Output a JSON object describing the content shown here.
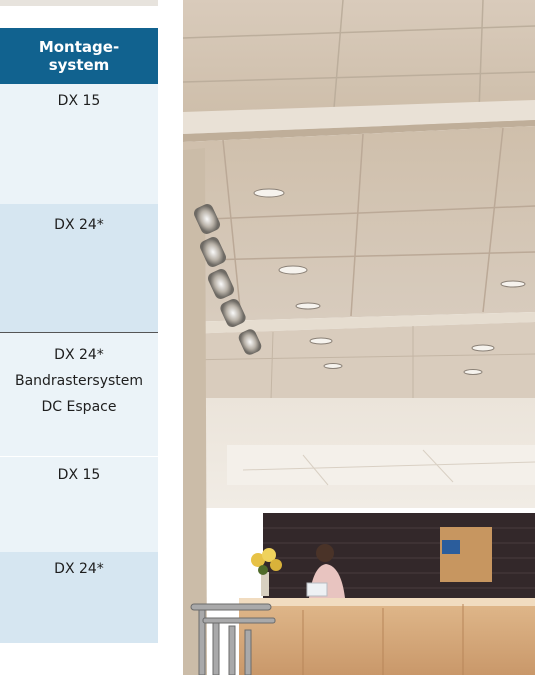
{
  "table": {
    "header": "Montage-\nsystem",
    "header_lines": [
      "Montage-",
      "system"
    ],
    "rows": [
      {
        "lines": [
          "DX 15"
        ]
      },
      {
        "lines": [
          "DX 24*"
        ]
      },
      {
        "lines": [
          "DX 24*",
          "Bandrastersystem",
          "DC Espace"
        ]
      },
      {
        "lines": [
          "DX 15"
        ]
      },
      {
        "lines": [
          "DX 24*"
        ]
      }
    ]
  },
  "photo": {
    "subject": "office reception with suspended ceiling tiles, spotlights and reception desk"
  },
  "colors": {
    "header_bg": "#11628f",
    "row_light": "#ebf3f8",
    "row_medium": "#d6e6f1",
    "text": "#1e1e1e"
  }
}
